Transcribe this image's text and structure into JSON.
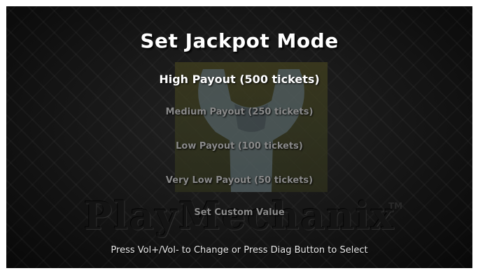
{
  "title": "Set Jackpot Mode",
  "options": [
    {
      "label": "High Payout (500 tickets)",
      "selected": true
    },
    {
      "label": "Medium Payout (250 tickets)",
      "selected": false
    },
    {
      "label": "Low Payout (100 tickets)",
      "selected": false
    },
    {
      "label": "Very Low Payout (50 tickets)",
      "selected": false
    },
    {
      "label": "Set Custom Value",
      "selected": false
    }
  ],
  "instructions": "Press Vol+/Vol- to Change or Press Diag Button to Select",
  "brand": {
    "name": "PlayMechanix",
    "trademark": "TM",
    "logo_icon": "wrench-icon"
  },
  "colors": {
    "selected_text": "#ffffff",
    "unselected_text": "#8a8a8a",
    "background": "#0d0d0d",
    "logo_panel": "#3a3a1e"
  }
}
